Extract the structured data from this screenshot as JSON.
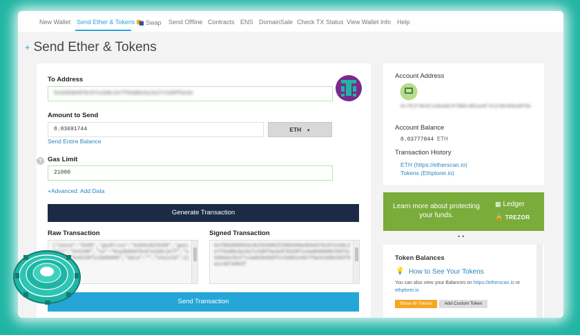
{
  "nav": {
    "items": [
      "New Wallet",
      "Send Ether & Tokens",
      "Swap",
      "Send Offline",
      "Contracts",
      "ENS",
      "DomainSale",
      "Check TX Status",
      "View Wallet Info",
      "Help"
    ],
    "active": "Send Ether & Tokens"
  },
  "page": {
    "title": "Send Ether & Tokens",
    "plus": "+"
  },
  "form": {
    "to_label": "To Address",
    "to_value": "0xA3b9d4F9c07e1b8c2e7f94d0e3a1b27c5d9f6a3e",
    "amount_label": "Amount to Send",
    "amount_value": "0.03691744",
    "currency": "ETH",
    "entire_balance": "Send Entire Balance",
    "gas_label": "Gas Limit",
    "gas_value": "21000",
    "advanced": "+Advanced: Add Data",
    "generate": "Generate Transaction",
    "raw_label": "Raw Transaction",
    "raw_value": "{\"nonce\":\"0x00\",\"gasPrice\":\"0x04e3b29200\",\"gasLimit\":\"0x5208\",\"to\":\"0xa3b9d4f9c07e1b8c2e7f\",\"value\":\"0x8328f1c0a8b000\",\"data\":\"\",\"chainId\":1}",
    "signed_label": "Signed Transaction",
    "signed_value": "0xf86b808504e3b292008252089400a3b9d4f9c07e1b8c2e7f94d0e3a1b27c5d9f6a3e878328f1c0a8b00080259f3c6d9a5e2b1f7c4a8d3e6b9f2c5a8d1e4b7f0a3c6d9e2b5f8a1c4d7e0b3f",
    "send": "Send Transaction"
  },
  "account": {
    "address_label": "Account Address",
    "address_value": "0x7E2f9b4C1d8a6E3f5B0c9D2a4F7e1C8b3D6a9F0e",
    "balance_label": "Account Balance",
    "balance_value": "0.03777844",
    "balance_unit": "ETH",
    "history_label": "Transaction History",
    "history_links": [
      "ETH (https://etherscan.io)",
      "Tokens (Ethplorer.io)"
    ]
  },
  "banner": {
    "text": "Learn more about protecting your funds.",
    "brand1": "Ledger",
    "brand2": "TREZOR",
    "color": "#7aac3b"
  },
  "tokens": {
    "title": "Token Balances",
    "how_to": "How to See Your Tokens",
    "desc_prefix": "You can also view your Balances on ",
    "link1": "https://etherscan.io",
    "desc_mid": " or",
    "link2": "ethplorer.io",
    "show_all": "Show All Tokens",
    "add_custom": "Add Custom Token"
  },
  "colors": {
    "accent": "#26a6d8",
    "navy": "#1c2b45",
    "teal_bg": "#1fb5a4",
    "orange": "#f5a623"
  }
}
